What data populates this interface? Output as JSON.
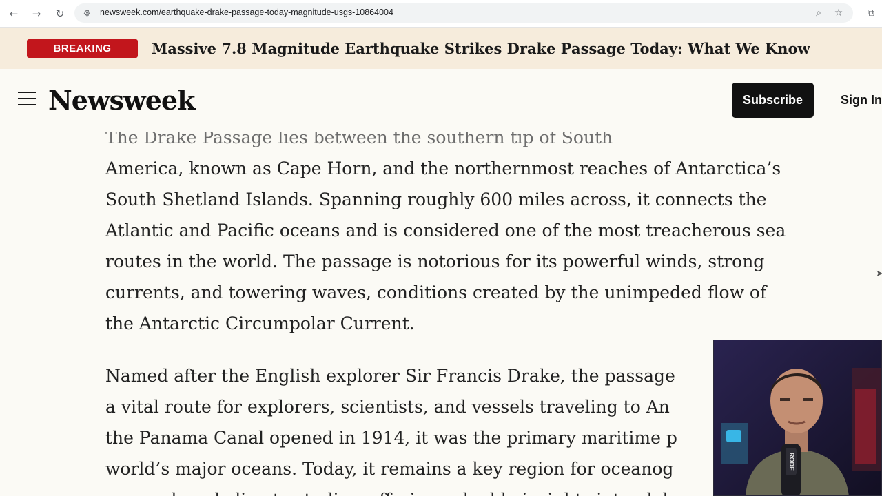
{
  "browser": {
    "url": "newsweek.com/earthquake-drake-passage-today-magnitude-usgs-10864004",
    "icons": {
      "back": "arrow-left-icon",
      "forward": "arrow-right-icon",
      "reload": "reload-icon",
      "site_info": "tune-icon",
      "zoom": "zoom-icon",
      "bookmark": "star-icon",
      "extensions": "puzzle-icon"
    }
  },
  "breaking": {
    "badge": "BREAKING",
    "headline": "Massive 7.8 Magnitude Earthquake Strikes Drake Passage Today: What We Know"
  },
  "header": {
    "logo": "Newsweek",
    "subscribe_label": "Subscribe",
    "signin_label": "Sign In"
  },
  "article": {
    "paragraph1_lines": [
      "The Drake Passage lies between the southern tip of South",
      "America, known as Cape Horn, and the northernmost reaches of Antarctica’s",
      "South Shetland Islands. Spanning roughly 600 miles across, it connects the",
      "Atlantic and Pacific oceans and is considered one of the most treacherous sea",
      "routes in the world. The passage is notorious for its powerful winds, strong",
      "currents, and towering waves, conditions created by the unimpeded flow of",
      "the Antarctic Circumpolar Current."
    ],
    "paragraph2_lines": [
      "Named after the English explorer Sir Francis Drake, the passage",
      "a vital route for explorers, scientists, and vessels traveling to An",
      "the Panama Canal opened in 1914, it was the primary maritime p",
      "world’s major oceans. Today, it remains a key region for oceanog",
      "research and climate studies, offering valuable insights into glob"
    ]
  },
  "webcam": {
    "mic_label": "RODE"
  },
  "colors": {
    "breaking_badge": "#c2161c",
    "breaking_bg": "#f6ecdc",
    "page_bg": "#fbfaf5",
    "subscribe_bg": "#111111"
  }
}
